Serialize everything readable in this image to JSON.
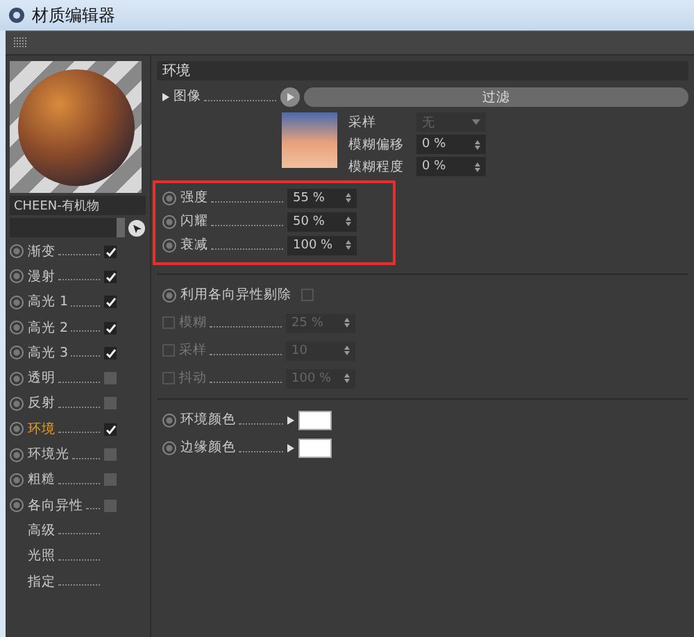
{
  "window": {
    "title": "材质编辑器"
  },
  "material": {
    "name": "CHEEN-有机物"
  },
  "channels": [
    {
      "kind": "toggle",
      "label": "渐变",
      "checked": true,
      "selected": false
    },
    {
      "kind": "toggle",
      "label": "漫射",
      "checked": true,
      "selected": false
    },
    {
      "kind": "toggle",
      "label": "高光 1",
      "checked": true,
      "selected": false
    },
    {
      "kind": "toggle",
      "label": "高光 2",
      "checked": true,
      "selected": false
    },
    {
      "kind": "toggle",
      "label": "高光 3",
      "checked": true,
      "selected": false
    },
    {
      "kind": "toggle",
      "label": "透明",
      "checked": false,
      "selected": false
    },
    {
      "kind": "toggle",
      "label": "反射",
      "checked": false,
      "selected": false
    },
    {
      "kind": "toggle",
      "label": "环境",
      "checked": true,
      "selected": true
    },
    {
      "kind": "toggle",
      "label": "环境光",
      "checked": false,
      "selected": false
    },
    {
      "kind": "toggle",
      "label": "粗糙",
      "checked": false,
      "selected": false
    },
    {
      "kind": "toggle",
      "label": "各向异性",
      "checked": false,
      "selected": false
    },
    {
      "kind": "plain",
      "label": "高级",
      "selected": false
    },
    {
      "kind": "plain",
      "label": "光照",
      "selected": false
    },
    {
      "kind": "plain",
      "label": "指定",
      "selected": false
    }
  ],
  "section": {
    "title": "环境",
    "image": {
      "label": "图像",
      "button": "过滤"
    },
    "sampling": [
      {
        "kind": "select",
        "label": "采样",
        "value": "无"
      },
      {
        "kind": "number",
        "label": "模糊偏移",
        "value": "0 %"
      },
      {
        "kind": "number",
        "label": "模糊程度",
        "value": "0 %"
      }
    ],
    "main": [
      {
        "label": "强度",
        "value": "55 %"
      },
      {
        "label": "闪耀",
        "value": "50 %"
      },
      {
        "label": "衰减",
        "value": "100 %"
      }
    ],
    "anisotropy": {
      "label": "利用各向异性剔除",
      "checked": false
    },
    "anisotropy_params": [
      {
        "label": "模糊",
        "value": "25 %",
        "disabled": true,
        "checked": false
      },
      {
        "label": "采样",
        "value": "10",
        "disabled": true,
        "checked": false
      },
      {
        "label": "抖动",
        "value": "100 %",
        "disabled": true,
        "checked": false
      }
    ],
    "colors": [
      {
        "label": "环境颜色",
        "color": "#ffffff"
      },
      {
        "label": "边缘颜色",
        "color": "#ffffff"
      }
    ]
  }
}
